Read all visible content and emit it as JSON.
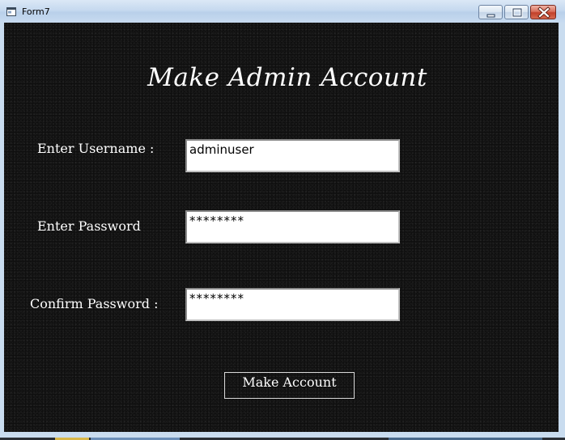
{
  "window": {
    "title": "Form7",
    "controls": {
      "minimize_icon": "minimize-icon",
      "maximize_icon": "maximize-icon",
      "close_icon": "close-icon"
    }
  },
  "form": {
    "heading": "Make Admin Account",
    "username": {
      "label": "Enter Username :",
      "value": "adminuser"
    },
    "password": {
      "label": "Enter Password",
      "value": "********"
    },
    "confirm": {
      "label": "Confirm Password :",
      "value": "********"
    },
    "submit_label": "Make Account"
  },
  "colors": {
    "background": "#0f0f0f",
    "text": "#ffffff",
    "titlebar": "#c6d9ef",
    "close_button": "#c2402a"
  }
}
